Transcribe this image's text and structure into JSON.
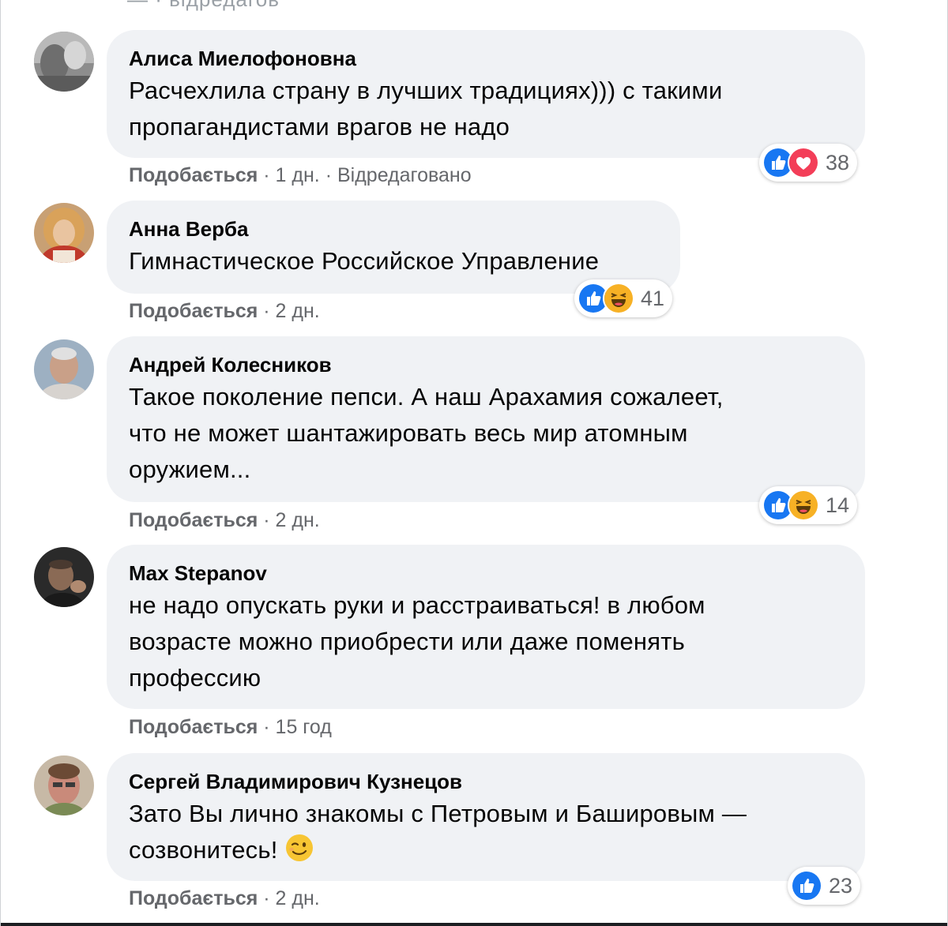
{
  "top_cut_text": "— · відредагов",
  "comments": [
    {
      "author": "Алиса Миелофоновна",
      "lines": [
        "Расчехлила страну в лучших традициях))) с такими",
        "пропагандистами врагов не надо"
      ],
      "like_label": "Подобається",
      "time": "1 дн.",
      "edited": "Відредаговано",
      "reactions": [
        "like-icon",
        "heart-icon"
      ],
      "reaction_count": "38"
    },
    {
      "author": "Анна Верба",
      "lines": [
        "Гимнастическое Российское Управление"
      ],
      "like_label": "Подобається",
      "time": "2 дн.",
      "edited": "",
      "reactions": [
        "like-icon",
        "haha-icon"
      ],
      "reaction_count": "41"
    },
    {
      "author": "Андрей Колесников",
      "lines": [
        "Такое поколение пепси. А наш Арахамия сожалеет,",
        "что не может шантажировать весь мир атомным",
        "оружием..."
      ],
      "like_label": "Подобається",
      "time": "2 дн.",
      "edited": "",
      "reactions": [
        "like-icon",
        "haha-icon"
      ],
      "reaction_count": "14"
    },
    {
      "author": "Max Stepanov",
      "lines": [
        "не надо опускать руки и расстраиваться! в любом",
        "возрасте можно приобрести или даже поменять",
        "профессию"
      ],
      "like_label": "Подобається",
      "time": "15 год",
      "edited": ""
    },
    {
      "author": "Сергей Владимирович Кузнецов",
      "lines": [
        "Зато Вы лично знакомы с Петровым и Башировым —",
        "созвонитесь!"
      ],
      "inline_emoji": "wink-emoji-icon",
      "like_label": "Подобається",
      "time": "2 дн.",
      "edited": "",
      "reactions": [
        "like-icon"
      ],
      "reaction_count": "23"
    }
  ],
  "colors": {
    "bubble_bg": "#f0f2f5",
    "meta_text": "#65676b",
    "like_blue": "#1877f2",
    "love_red": "#f33e58",
    "haha_yellow": "#f7b125"
  }
}
